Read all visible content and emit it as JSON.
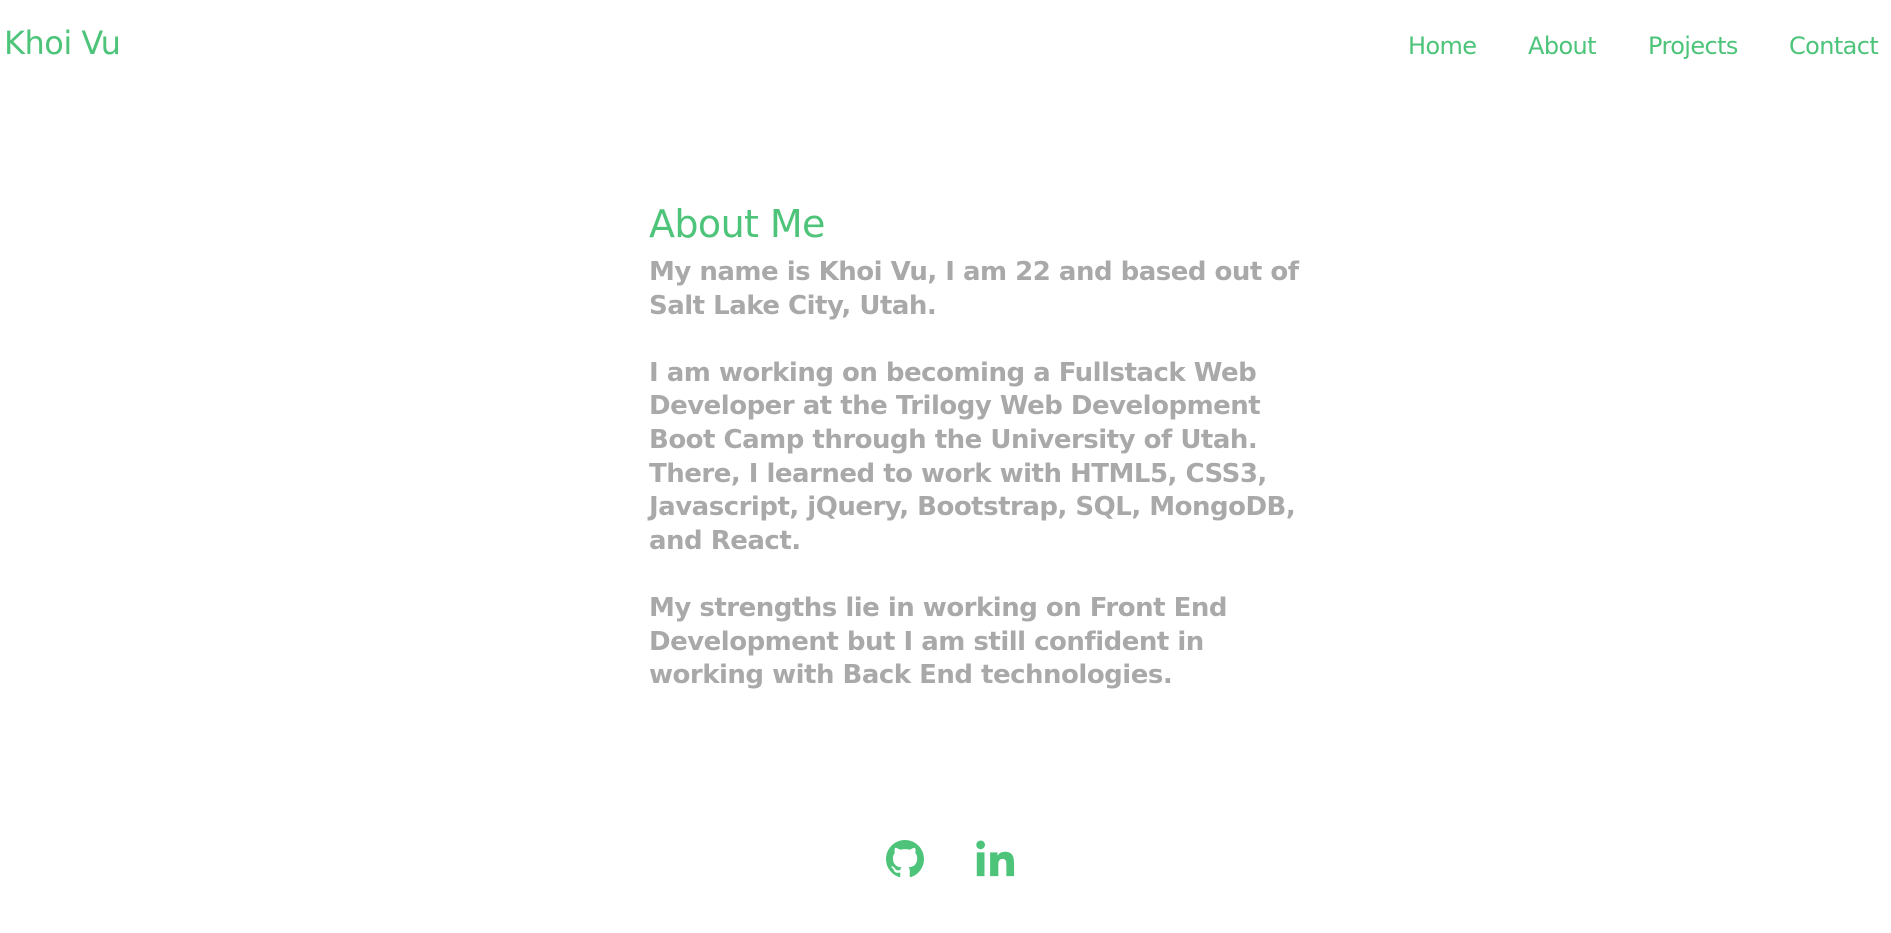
{
  "header": {
    "brand": "Khoi Vu",
    "nav": {
      "home": "Home",
      "about": "About",
      "projects": "Projects",
      "contact": "Contact"
    }
  },
  "about": {
    "title": "About Me",
    "paragraph_1": {
      "lines": [
        "My name is Khoi Vu, I am 22 and based out of",
        "Salt Lake City, Utah."
      ]
    },
    "paragraph_2": {
      "lines": [
        "I am working on becoming a Fullstack Web",
        "Developer at the Trilogy Web Development",
        "Boot Camp through the University of Utah.",
        "There, I learned to work with HTML5, CSS3,",
        "Javascript, jQuery, Bootstrap, SQL, MongoDB,",
        "and React."
      ]
    },
    "paragraph_3": {
      "lines": [
        "My strengths lie in working on Front End",
        "Development but I am still confident in",
        "working with Back End technologies."
      ]
    }
  },
  "social": {
    "github_icon": "github-icon",
    "linkedin_icon": "linkedin-icon"
  },
  "colors": {
    "accent": "#4dc47a",
    "body_text": "#a9a9a9",
    "background": "#ffffff"
  }
}
